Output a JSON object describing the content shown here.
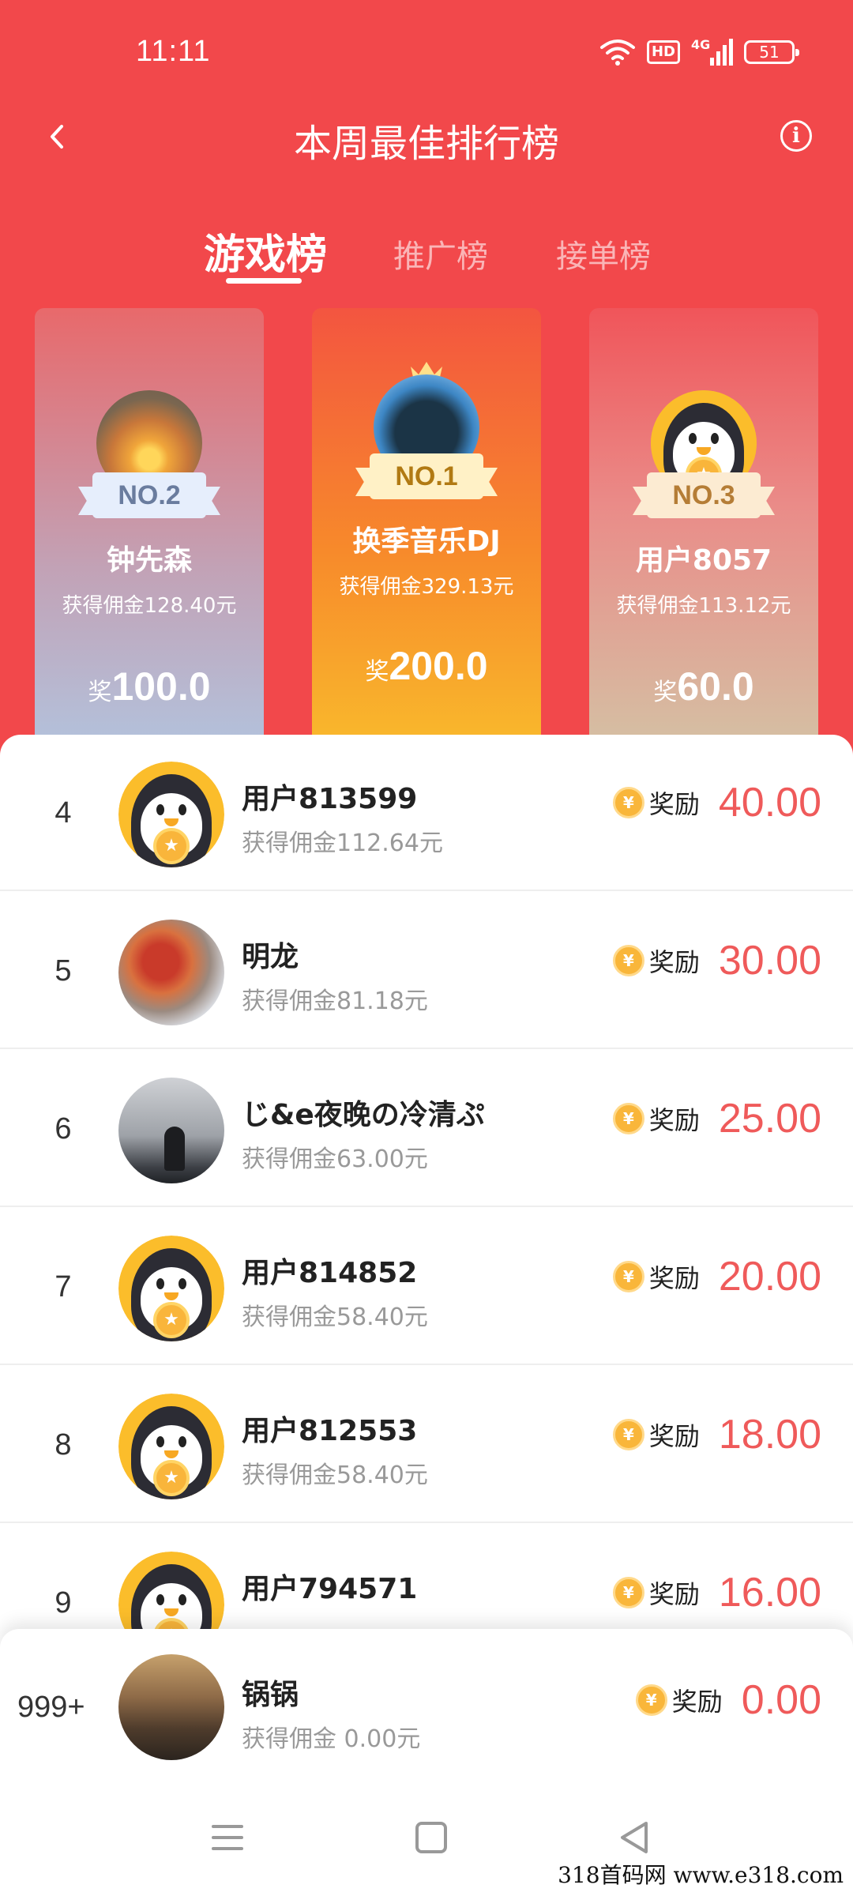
{
  "status_bar": {
    "time": "11:11",
    "hd": "HD",
    "network": "4G",
    "battery": "51"
  },
  "header": {
    "title": "本周最佳排行榜"
  },
  "tabs": [
    {
      "label": "游戏榜",
      "active": true
    },
    {
      "label": "推广榜",
      "active": false
    },
    {
      "label": "接单榜",
      "active": false
    }
  ],
  "podium": {
    "first": {
      "rank": "NO.1",
      "name": "换季音乐DJ",
      "commission": "获得佣金329.13元",
      "prize_prefix": "奖",
      "prize": "200.0"
    },
    "second": {
      "rank": "NO.2",
      "name": "钟先森",
      "commission": "获得佣金128.40元",
      "prize_prefix": "奖",
      "prize": "100.0"
    },
    "third": {
      "rank": "NO.3",
      "name": "用户8057",
      "commission": "获得佣金113.12元",
      "prize_prefix": "奖",
      "prize": "60.0"
    }
  },
  "reward_label": "奖励",
  "coin_symbol": "¥",
  "list": [
    {
      "rank": "4",
      "name": "用户813599",
      "commission": "获得佣金112.64元",
      "reward": "40.00",
      "avatar": "penguin"
    },
    {
      "rank": "5",
      "name": "明龙",
      "commission": "获得佣金81.18元",
      "reward": "30.00",
      "avatar": "photo"
    },
    {
      "rank": "6",
      "name": "じ&e夜晚の冷清ぷ",
      "commission": "获得佣金63.00元",
      "reward": "25.00",
      "avatar": "photo"
    },
    {
      "rank": "7",
      "name": "用户814852",
      "commission": "获得佣金58.40元",
      "reward": "20.00",
      "avatar": "penguin"
    },
    {
      "rank": "8",
      "name": "用户812553",
      "commission": "获得佣金58.40元",
      "reward": "18.00",
      "avatar": "penguin"
    },
    {
      "rank": "9",
      "name": "用户794571",
      "commission": "",
      "reward": "16.00",
      "avatar": "penguin"
    }
  ],
  "self": {
    "rank": "999+",
    "name": "锅锅",
    "commission": "获得佣金 0.00元",
    "reward": "0.00"
  },
  "watermark": "318首码网  www.e318.com",
  "colors": {
    "primary": "#f2484b",
    "reward": "#ef5a5a",
    "coin": "#f9b63a"
  }
}
